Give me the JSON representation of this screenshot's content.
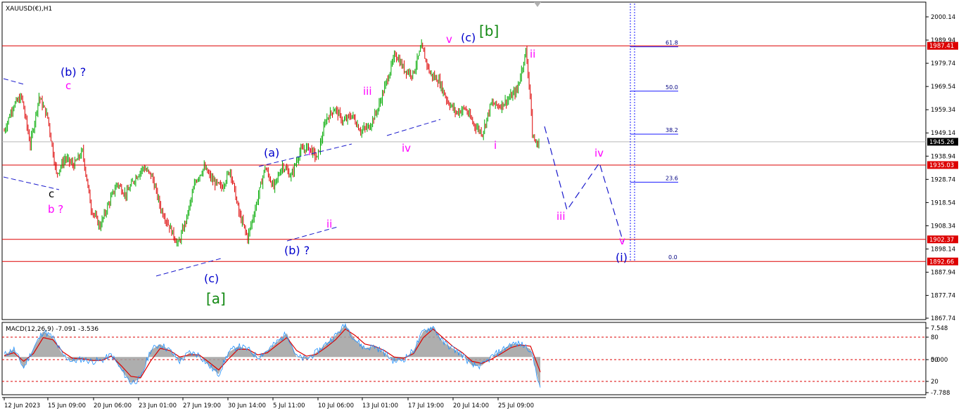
{
  "symbol_title": "XAUUSD(€),H1",
  "macd_title": "MACD(12,26,9) -7.091 -3.536",
  "colors": {
    "bull_candle": "#00aa00",
    "bear_candle": "#dd0000",
    "level_line": "#dd0000",
    "fib_line": "#1a1aff",
    "wave_blue": "#0000cc",
    "wave_magenta": "#ff00ff",
    "wave_green": "#118811",
    "macd_hist": "#a0a0a0",
    "macd_signal": "#dd0000",
    "macd_line": "#1e90ff"
  },
  "chart_data": [
    {
      "type": "candlestick",
      "title": "XAUUSD(€),H1",
      "y_ticks": [
        "2000.14",
        "1989.94",
        "1979.74",
        "1969.54",
        "1959.34",
        "1949.14",
        "1938.94",
        "1928.74",
        "1918.54",
        "1908.34",
        "1898.14",
        "1887.94",
        "1877.74",
        "1867.74"
      ],
      "ylim": [
        1867.74,
        2000.14
      ],
      "x_ticks": [
        "12 Jun 2023",
        "15 Jun 09:00",
        "20 Jun 06:00",
        "23 Jun 01:00",
        "27 Jun 19:00",
        "30 Jun 14:00",
        "5 Jul 11:00",
        "10 Jul 06:00",
        "13 Jul 01:00",
        "17 Jul 19:00",
        "20 Jul 14:00",
        "25 Jul 09:00"
      ],
      "current_price": "1945.26",
      "price_path": [
        [
          0,
          1950
        ],
        [
          8,
          1961
        ],
        [
          16,
          1965
        ],
        [
          24,
          1944
        ],
        [
          32,
          1965
        ],
        [
          40,
          1956
        ],
        [
          48,
          1931
        ],
        [
          56,
          1938
        ],
        [
          64,
          1935
        ],
        [
          72,
          1941
        ],
        [
          80,
          1916
        ],
        [
          88,
          1908
        ],
        [
          96,
          1918
        ],
        [
          104,
          1927
        ],
        [
          112,
          1922
        ],
        [
          120,
          1929
        ],
        [
          128,
          1934
        ],
        [
          136,
          1930
        ],
        [
          144,
          1916
        ],
        [
          152,
          1908
        ],
        [
          160,
          1900
        ],
        [
          168,
          1912
        ],
        [
          176,
          1928
        ],
        [
          184,
          1934
        ],
        [
          192,
          1928
        ],
        [
          200,
          1925
        ],
        [
          208,
          1933
        ],
        [
          216,
          1914
        ],
        [
          224,
          1903
        ],
        [
          232,
          1918
        ],
        [
          240,
          1934
        ],
        [
          248,
          1925
        ],
        [
          256,
          1935
        ],
        [
          264,
          1930
        ],
        [
          272,
          1941
        ],
        [
          280,
          1943
        ],
        [
          288,
          1938
        ],
        [
          296,
          1955
        ],
        [
          304,
          1960
        ],
        [
          312,
          1954
        ],
        [
          320,
          1957
        ],
        [
          328,
          1950
        ],
        [
          336,
          1952
        ],
        [
          344,
          1960
        ],
        [
          352,
          1972
        ],
        [
          360,
          1984
        ],
        [
          368,
          1977
        ],
        [
          376,
          1975
        ],
        [
          384,
          1987
        ],
        [
          392,
          1975
        ],
        [
          400,
          1972
        ],
        [
          408,
          1963
        ],
        [
          416,
          1958
        ],
        [
          424,
          1960
        ],
        [
          432,
          1953
        ],
        [
          440,
          1949
        ],
        [
          448,
          1962
        ],
        [
          456,
          1961
        ],
        [
          464,
          1964
        ],
        [
          472,
          1968
        ],
        [
          480,
          1985
        ],
        [
          484,
          1966
        ],
        [
          486,
          1948
        ],
        [
          490,
          1944
        ],
        [
          492,
          1945
        ]
      ],
      "levels": [
        {
          "label": "1987.41",
          "price": 1987.41
        },
        {
          "label": "1935.03",
          "price": 1935.03
        },
        {
          "label": "1902.37",
          "price": 1902.37
        },
        {
          "label": "1892.66",
          "price": 1892.66
        }
      ],
      "fibonacci": [
        {
          "label": "61.8",
          "price": 1987.0
        },
        {
          "label": "50.0",
          "price": 1967.5
        },
        {
          "label": "38.2",
          "price": 1948.6
        },
        {
          "label": "23.6",
          "price": 1927.5
        },
        {
          "label": "0.0",
          "price": 1892.7
        }
      ],
      "wave_labels": [
        "(b) ?",
        "c",
        "c",
        "b ?",
        "(c)",
        "[a]",
        "(a)",
        "i",
        "(b) ?",
        "ii",
        "iii",
        "iv",
        "v",
        "(c)",
        "[b]",
        "ii",
        "i",
        "iv",
        "iii",
        "v",
        "(i)"
      ]
    },
    {
      "type": "macd",
      "title": "MACD(12,26,9) -7.091 -3.536",
      "params": [
        12,
        26,
        9
      ],
      "macd_value": -7.091,
      "signal_value": -3.536,
      "y_ticks": [
        "7.548",
        "80",
        "0.000",
        "50",
        "20",
        "-7.788"
      ],
      "ylim": [
        -7.788,
        7.548
      ],
      "series": [
        {
          "name": "MACD",
          "values": [
            0.5,
            1.8,
            -2.5,
            2.0,
            6.0,
            4.5,
            0.5,
            -1.0,
            -0.5,
            -1.0,
            -0.8,
            0.5,
            -3.0,
            -6.0,
            -5.0,
            1.5,
            3.0,
            1.5,
            -1.0,
            1.0,
            0.5,
            -2.0,
            -4.0,
            1.0,
            2.5,
            1.8,
            0.0,
            1.5,
            3.5,
            5.5,
            0.0,
            -0.5,
            1.0,
            3.0,
            5.0,
            7.5,
            4.0,
            2.0,
            2.5,
            1.0,
            -1.0,
            -0.5,
            1.5,
            6.0,
            7.0,
            3.5,
            2.0,
            0.5,
            -2.0,
            -2.0,
            0.0,
            1.5,
            3.0,
            3.0,
            1.8,
            -7.1
          ]
        },
        {
          "name": "Signal",
          "values": [
            0.3,
            1.0,
            -1.0,
            0.8,
            4.5,
            4.0,
            1.2,
            -0.3,
            -0.4,
            -0.8,
            -0.8,
            0.2,
            -2.0,
            -4.5,
            -4.8,
            -1.0,
            2.0,
            1.5,
            0.0,
            0.5,
            0.5,
            -1.2,
            -3.0,
            -0.5,
            1.8,
            1.8,
            0.5,
            1.0,
            2.8,
            4.5,
            1.5,
            0.2,
            0.6,
            2.2,
            4.0,
            6.5,
            5.0,
            3.0,
            2.5,
            1.5,
            0.0,
            -0.3,
            0.8,
            4.5,
            6.5,
            4.5,
            2.5,
            1.0,
            -1.0,
            -1.5,
            -0.5,
            0.8,
            2.2,
            2.8,
            2.5,
            -3.5
          ]
        }
      ]
    }
  ]
}
